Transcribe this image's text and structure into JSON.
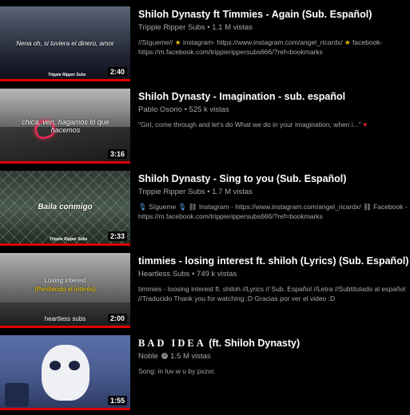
{
  "videos": [
    {
      "title": "Shiloh Dynasty ft Timmies - Again (Sub. Español)",
      "channel": "Trippie Ripper Subs",
      "views": "1.1 M vistas",
      "desc_a": "//Sígueme//",
      "desc_b": "instagram- https://www.instagram.com/angel_ricardx/",
      "desc_c": "facebook-",
      "desc_d": "https://m.facebook.com/trippierippersubs666/?ref=bookmarks",
      "duration": "2:40",
      "thumb_caption": "Nena oh, si tuviera el dinero, amor",
      "thumb_credit": "Trippie Ripper Subs"
    },
    {
      "title": "Shiloh Dynasty - Imagination - sub. español",
      "channel": "Pablo Osorio",
      "views": "525 k vistas",
      "desc_a": "\"Girl, come through and let's do What we do in your imagination, when i...\"",
      "duration": "3:16",
      "thumb_caption": "chica, ven, hagamos lo que hacemos"
    },
    {
      "title": "Shiloh Dynasty - Sing to you (Sub. Español)",
      "channel": "Trippie Ripper Subs",
      "views": "1.7 M vistas",
      "desc_a": "Sígueme",
      "desc_b": "Instagram - https://www.instagram.com/angel_ricardx/",
      "desc_c": "Facebook -",
      "desc_d": "https://m.facebook.com/trippierippersubs666/?ref=bookmarks",
      "duration": "2:33",
      "thumb_caption": "Baila conmigo",
      "thumb_credit": "Trippie Ripper Subs"
    },
    {
      "title": "timmies - losing interest ft. shiloh (Lyrics) (Sub. Español)",
      "channel": "Heartless Subs",
      "views": "749 k vistas",
      "desc_a": "timmies - loosing interest ft. shiloh //Lyrics // Sub. Español //Letra //Subtitulado al español //Traducido Thank you for watching :D Gracias por ver el video :D",
      "duration": "2:00",
      "thumb_caption": "Losing interest",
      "thumb_caption2": "(Perdiendo el interés)",
      "thumb_credit": "heartless subs"
    },
    {
      "title_a": "BAD IDEA",
      "title_b": " (ft. Shiloh Dynasty)",
      "channel": "Noble",
      "views": "1.5 M vistas",
      "desc_a": "Song: in luv w u by pxzvc",
      "duration": "1:55"
    }
  ],
  "colors": {
    "progress": "#e00000",
    "meta_text": "#aaaaaa",
    "background": "#000000"
  },
  "icons": [
    "star-icon",
    "heart-icon",
    "link-icon",
    "mic-icon",
    "verified-icon"
  ]
}
